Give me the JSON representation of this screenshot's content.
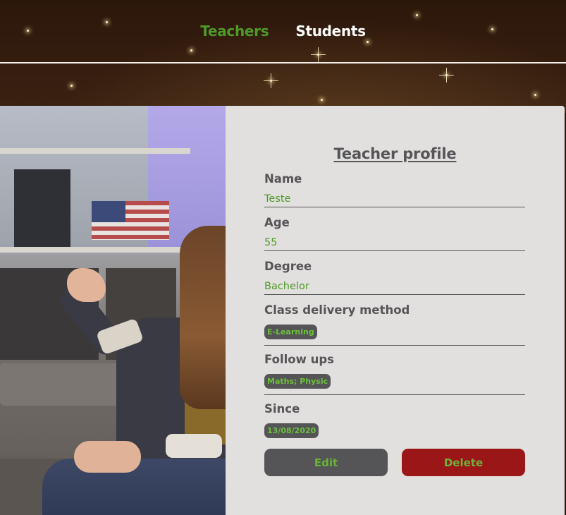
{
  "nav": {
    "items": [
      {
        "label": "Teachers",
        "active": true
      },
      {
        "label": "Students",
        "active": false
      }
    ],
    "active_color": "#4e9b27",
    "inactive_color": "#ffffff"
  },
  "photo": {
    "icon": "teacher-photo"
  },
  "profile": {
    "title": "Teacher profile",
    "fields": {
      "name": {
        "label": "Name",
        "value": "Teste"
      },
      "age": {
        "label": "Age",
        "value": "55"
      },
      "degree": {
        "label": "Degree",
        "value": "Bachelor"
      },
      "delivery": {
        "label": "Class delivery method",
        "chip": "E-Learning"
      },
      "followups": {
        "label": "Follow ups",
        "chip": "Maths; Physic"
      },
      "since": {
        "label": "Since",
        "chip": "13/08/2020"
      }
    },
    "buttons": {
      "edit": "Edit",
      "delete": "Delete"
    },
    "colors": {
      "card_bg": "#e2dfdf",
      "value_text": "#4e9b27",
      "delete_bg": "#9b1616",
      "edit_bg": "#555557"
    }
  }
}
